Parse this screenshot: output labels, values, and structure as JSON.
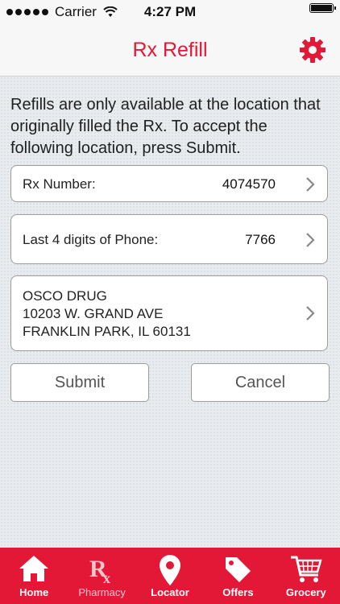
{
  "status_bar": {
    "carrier": "Carrier",
    "time": "4:27 PM"
  },
  "header": {
    "title": "Rx Refill"
  },
  "intro_text": "Refills are only available at the location that originally filled the Rx. To accept the following location, press Submit.",
  "fields": [
    {
      "label": "Rx Number:",
      "value": "4074570"
    },
    {
      "label": "Last 4 digits of Phone:",
      "value": "7766"
    }
  ],
  "location": {
    "name": "OSCO DRUG",
    "street": "10203 W. GRAND AVE",
    "city": "FRANKLIN PARK, IL 60131"
  },
  "buttons": {
    "submit": "Submit",
    "cancel": "Cancel"
  },
  "tabs": [
    {
      "label": "Home",
      "icon": "home-icon"
    },
    {
      "label": "Pharmacy",
      "icon": "rx-icon"
    },
    {
      "label": "Locator",
      "icon": "map-pin-icon"
    },
    {
      "label": "Offers",
      "icon": "tag-icon"
    },
    {
      "label": "Grocery",
      "icon": "cart-icon"
    }
  ],
  "colors": {
    "brand": "#e31837",
    "background": "#e9ecef"
  }
}
